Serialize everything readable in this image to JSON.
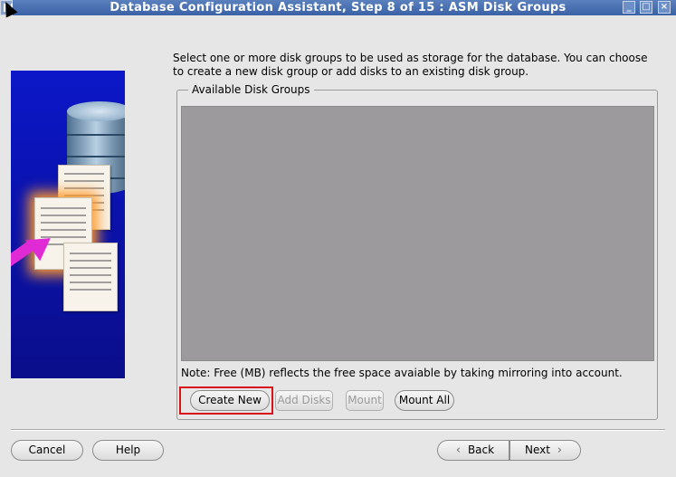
{
  "window": {
    "title": "Database Configuration Assistant, Step 8 of 15 : ASM Disk Groups",
    "minimize_label": "_",
    "maximize_label": "□",
    "close_label": "×"
  },
  "instructions": "Select one or more disk groups to be used as storage for the database. You can choose to create a new disk group or add disks to an existing disk group.",
  "disk_groups": {
    "legend": "Available Disk Groups",
    "note": "Note: Free (MB) reflects the free space avaiable by taking mirroring into account."
  },
  "actions": {
    "create_new": "Create New",
    "add_disks": "Add Disks",
    "mount": "Mount",
    "mount_all": "Mount All"
  },
  "footer": {
    "cancel": "Cancel",
    "help": "Help",
    "back": "Back",
    "next": "Next",
    "back_icon": "‹",
    "next_icon": "›"
  },
  "colors": {
    "titlebar": "#3b62a6",
    "list_background": "#9c9a9c",
    "highlight": "#d8141a"
  }
}
